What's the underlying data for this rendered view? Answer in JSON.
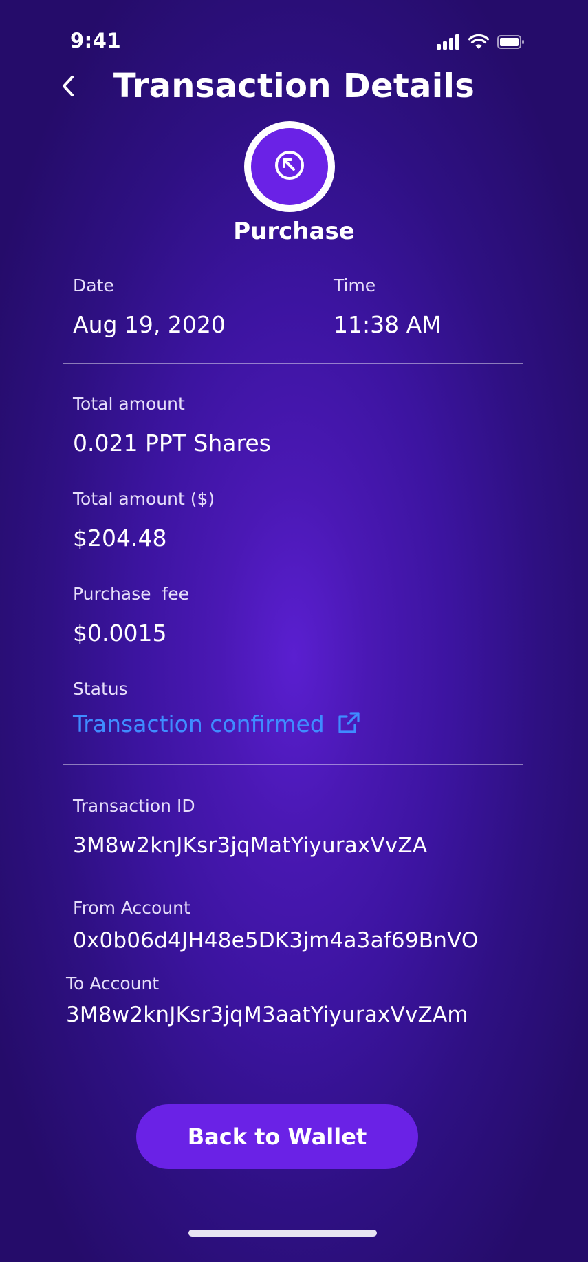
{
  "status_bar": {
    "time": "9:41"
  },
  "header": {
    "title": "Transaction Details",
    "back_icon": "chevron-left-icon"
  },
  "transaction": {
    "type_icon": "arrow-up-left-circle-icon",
    "type_label": "Purchase"
  },
  "details": {
    "date": {
      "label": "Date",
      "value": "Aug 19, 2020"
    },
    "time": {
      "label": "Time",
      "value": "11:38 AM"
    },
    "total_amount": {
      "label": "Total amount",
      "value": "0.021 PPT Shares"
    },
    "total_amount_usd": {
      "label": "Total amount ($)",
      "value": "$204.48"
    },
    "purchase_fee": {
      "label": "Purchase  fee",
      "value": "$0.0015"
    },
    "status": {
      "label": "Status",
      "value": "Transaction confirmed",
      "icon": "external-link-icon"
    },
    "transaction_id": {
      "label": "Transaction ID",
      "value": "3M8w2knJKsr3jqMatYiyuraxVvZA"
    },
    "from_account": {
      "label": "From Account",
      "value": "0x0b06d4JH48e5DK3jm4a3af69BnVO"
    },
    "to_account": {
      "label": "To Account",
      "value": "3M8w2knJKsr3jqM3aatYiyuraxVvZAm"
    }
  },
  "actions": {
    "back_to_wallet": "Back to Wallet"
  },
  "colors": {
    "background": "#3c14a0",
    "accent": "#6a22e6",
    "link": "#3f8cff",
    "text": "#ffffff"
  }
}
